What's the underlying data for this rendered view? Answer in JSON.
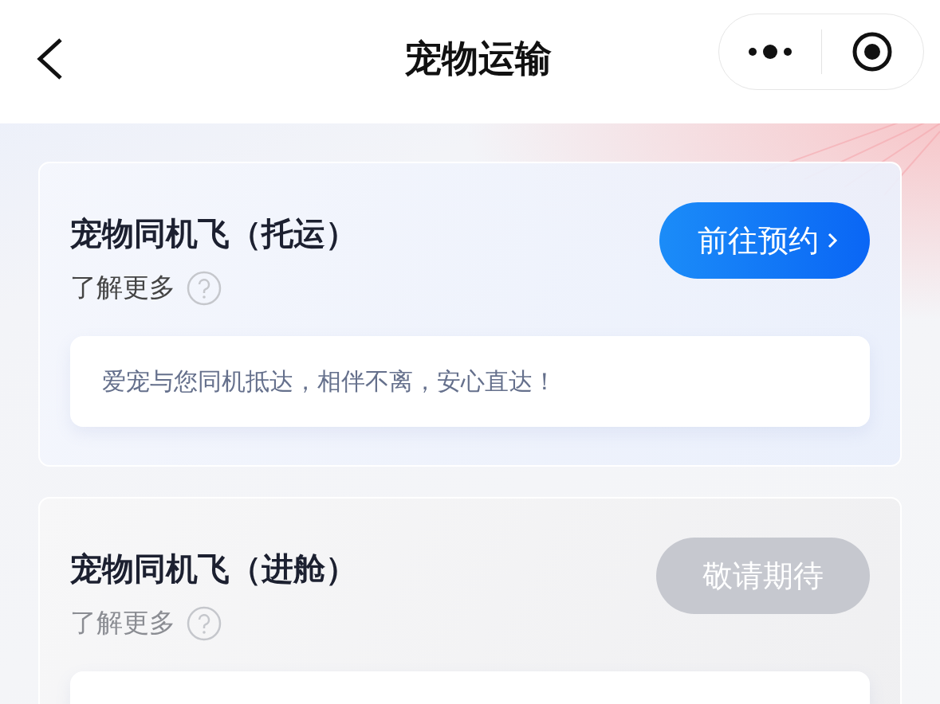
{
  "nav_bar": {
    "title": "宠物运输"
  },
  "services": [
    {
      "title": "宠物同机飞（托运）",
      "learn_more": "了解更多",
      "button": "前往预约",
      "disabled": false,
      "description": "爱宠与您同机抵达，相伴不离，安心直达！"
    },
    {
      "title": "宠物同机飞（进舱）",
      "learn_more": "了解更多",
      "button": "敬请期待",
      "disabled": true
    }
  ]
}
